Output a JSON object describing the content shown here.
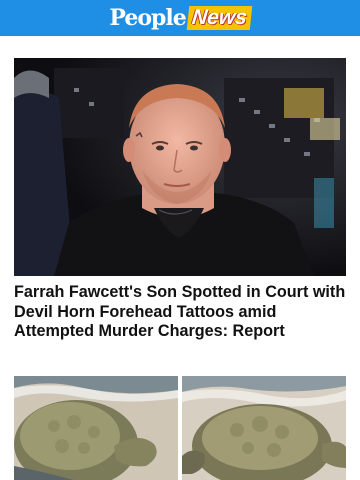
{
  "header": {
    "logo_people": "People",
    "logo_news": "News",
    "bg_color": "#1f8fe6",
    "accent_color": "#f5c400"
  },
  "articles": [
    {
      "headline": "Farrah Fawcett's Son Spotted in Court with Devil Horn Forehead Tattoos amid Attempted Murder Charges: Report",
      "image_icon": "photo-man-portrait"
    },
    {
      "headline": "",
      "image_icon": "photo-sea-turtle"
    }
  ]
}
